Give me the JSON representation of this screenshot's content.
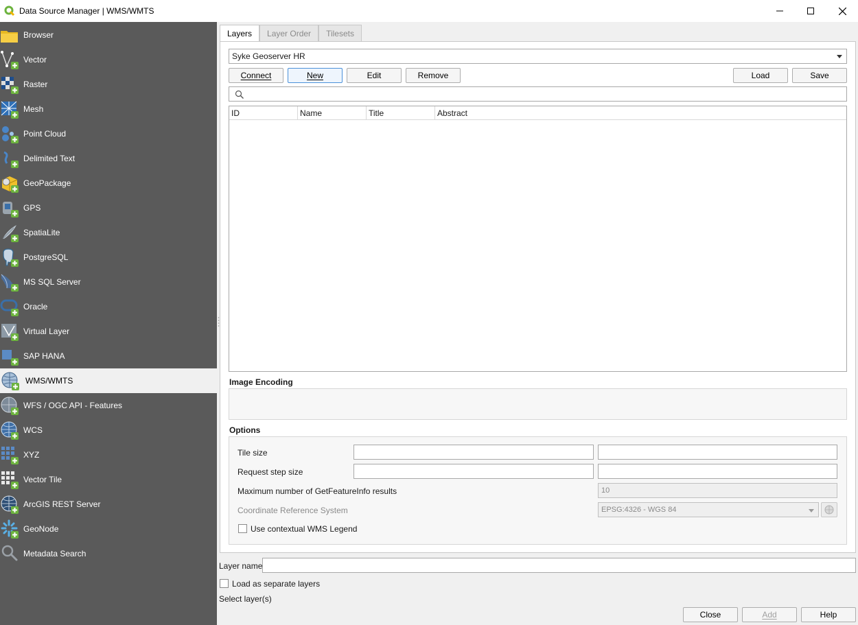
{
  "window": {
    "title": "Data Source Manager | WMS/WMTS"
  },
  "sidebar": {
    "items": [
      {
        "label": "Browser",
        "icon": "folder-icon"
      },
      {
        "label": "Vector",
        "icon": "vector-icon"
      },
      {
        "label": "Raster",
        "icon": "raster-icon"
      },
      {
        "label": "Mesh",
        "icon": "mesh-icon"
      },
      {
        "label": "Point Cloud",
        "icon": "point-cloud-icon"
      },
      {
        "label": "Delimited Text",
        "icon": "delimited-text-icon"
      },
      {
        "label": "GeoPackage",
        "icon": "geopackage-icon"
      },
      {
        "label": "GPS",
        "icon": "gps-icon"
      },
      {
        "label": "SpatiaLite",
        "icon": "spatialite-icon"
      },
      {
        "label": "PostgreSQL",
        "icon": "postgresql-icon"
      },
      {
        "label": "MS SQL Server",
        "icon": "mssql-icon"
      },
      {
        "label": "Oracle",
        "icon": "oracle-icon"
      },
      {
        "label": "Virtual Layer",
        "icon": "virtual-layer-icon"
      },
      {
        "label": "SAP HANA",
        "icon": "sap-hana-icon"
      },
      {
        "label": "WMS/WMTS",
        "icon": "wms-icon",
        "active": true
      },
      {
        "label": "WFS / OGC API - Features",
        "icon": "wfs-icon"
      },
      {
        "label": "WCS",
        "icon": "wcs-icon"
      },
      {
        "label": "XYZ",
        "icon": "xyz-icon"
      },
      {
        "label": "Vector Tile",
        "icon": "vector-tile-icon"
      },
      {
        "label": "ArcGIS REST Server",
        "icon": "arcgis-icon"
      },
      {
        "label": "GeoNode",
        "icon": "geonode-icon"
      },
      {
        "label": "Metadata Search",
        "icon": "metadata-search-icon"
      }
    ]
  },
  "tabs": [
    {
      "label": "Layers",
      "active": true
    },
    {
      "label": "Layer Order",
      "active": false
    },
    {
      "label": "Tilesets",
      "active": false
    }
  ],
  "connection": {
    "selected": "Syke Geoserver HR"
  },
  "buttons": {
    "connect_label": "Connect",
    "new_label": "New",
    "edit_label": "Edit",
    "remove_label": "Remove",
    "load_label": "Load",
    "save_label": "Save"
  },
  "search": {
    "placeholder": ""
  },
  "layers_table": {
    "columns": [
      "ID",
      "Name",
      "Title",
      "Abstract"
    ],
    "rows": []
  },
  "image_encoding": {
    "label": "Image Encoding"
  },
  "options": {
    "label": "Options",
    "tile_size_label": "Tile size",
    "tile_size_w": "",
    "tile_size_h": "",
    "request_step_label": "Request step size",
    "request_step_w": "",
    "request_step_h": "",
    "max_featureinfo_label": "Maximum number of GetFeatureInfo results",
    "max_featureinfo_value": "10",
    "crs_label": "Coordinate Reference System",
    "crs_value": "EPSG:4326 - WGS 84",
    "contextual_legend_label": "Use contextual WMS Legend",
    "contextual_legend_checked": false
  },
  "bottom": {
    "layer_name_label": "Layer name",
    "layer_name_value": "",
    "separate_layers_label": "Load as separate layers",
    "separate_layers_checked": false,
    "status_text": "Select layer(s)",
    "close_label": "Close",
    "add_label": "Add",
    "help_label": "Help"
  },
  "colors": {
    "sidebar_bg": "#5a5a5a",
    "sidebar_active_bg": "#f0f0f0",
    "qgis_green": "#6cb33e",
    "focus_blue": "#4a90d9"
  }
}
